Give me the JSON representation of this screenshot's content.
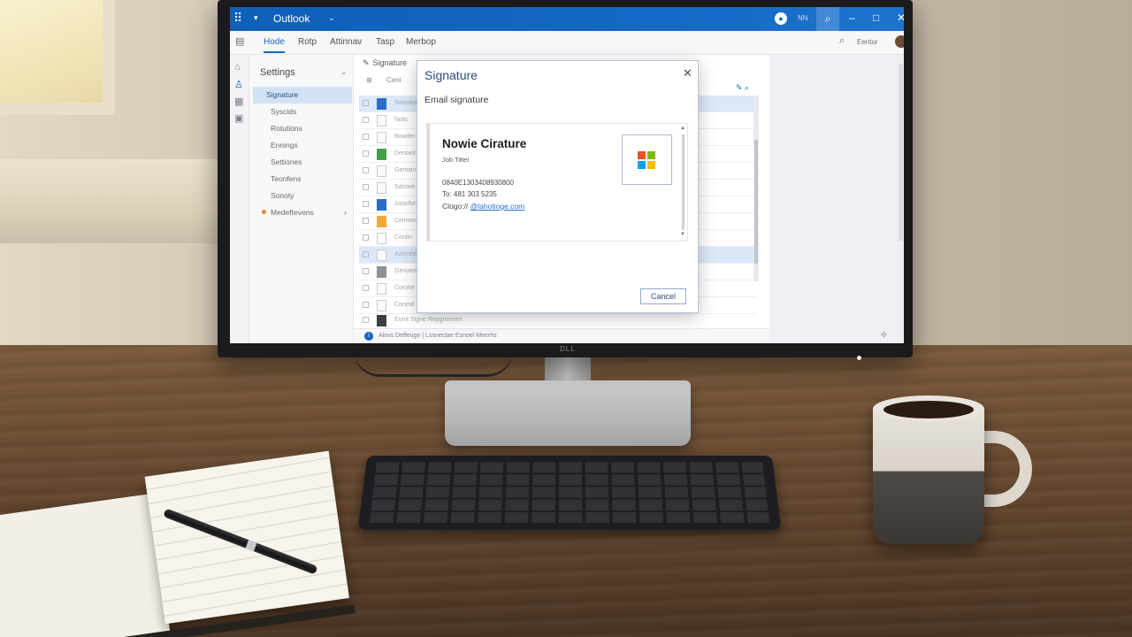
{
  "titlebar": {
    "app_title": "Outlook",
    "waffle_icon": "app-launcher-icon",
    "user_mini": "NN"
  },
  "ribbon": {
    "tabs": [
      {
        "label": "Hode",
        "active": true
      },
      {
        "label": "Rotp",
        "active": false
      },
      {
        "label": "Attinnav",
        "active": false
      },
      {
        "label": "Tasp",
        "active": false
      },
      {
        "label": "Merbop",
        "active": false
      }
    ],
    "user_label": "Eentor"
  },
  "settings": {
    "header": "Settings",
    "items": [
      {
        "label": "Signature",
        "active": true
      },
      {
        "label": "Syscids",
        "active": false
      },
      {
        "label": "Rotutions",
        "active": false
      },
      {
        "label": "Ennings",
        "active": false
      },
      {
        "label": "Settiones",
        "active": false
      },
      {
        "label": "Teonfens",
        "active": false
      },
      {
        "label": "Sonoty",
        "active": false
      },
      {
        "label": "Medeftevens",
        "active": false,
        "has_dot": true,
        "has_chevron": true
      }
    ]
  },
  "message_list": {
    "header": "Signature",
    "toolbar_text": "Ceni",
    "rows": [
      {
        "text": "Sotuston",
        "icon": "blue",
        "selected": true
      },
      {
        "text": "Notic",
        "icon": "plain",
        "selected": false
      },
      {
        "text": "Bowder",
        "icon": "plain",
        "selected": false
      },
      {
        "text": "Denoeit",
        "icon": "green",
        "selected": false
      },
      {
        "text": "Gemaing",
        "icon": "plain",
        "selected": false
      },
      {
        "text": "Sdrowe",
        "icon": "plain",
        "selected": false
      },
      {
        "text": "Asoofors",
        "icon": "blue",
        "selected": false
      },
      {
        "text": "Ceinoed",
        "icon": "orange",
        "selected": false
      },
      {
        "text": "Conlin",
        "icon": "plain",
        "selected": false
      },
      {
        "text": "Azirmno",
        "icon": "plain",
        "selected": true
      },
      {
        "text": "Genoed",
        "icon": "gray",
        "selected": false
      },
      {
        "text": "Coroter",
        "icon": "plain",
        "selected": false
      },
      {
        "text": "Coneal",
        "icon": "plain",
        "selected": false
      },
      {
        "text": "Eonit Signe Repgnemert",
        "icon": "dark",
        "selected": false
      }
    ],
    "status_text": "Alovs Deffeuge | Lssnectae Esnoel Meerhs"
  },
  "dialog": {
    "title": "Signature",
    "subtitle": "Email signature",
    "signature": {
      "name": "Nowie Ciraturе",
      "job_title": "Job Tittel",
      "line1": "0840E1303408930800",
      "line2": "To: 481 303 5235",
      "line3_prefix": "Clogo://",
      "line3_link": "@lahotioge.com"
    },
    "logo_colors": [
      "#f25022",
      "#7fba00",
      "#00a4ef",
      "#ffb900"
    ],
    "cancel_label": "Cancel"
  },
  "monitor": {
    "brand": "DLL"
  }
}
